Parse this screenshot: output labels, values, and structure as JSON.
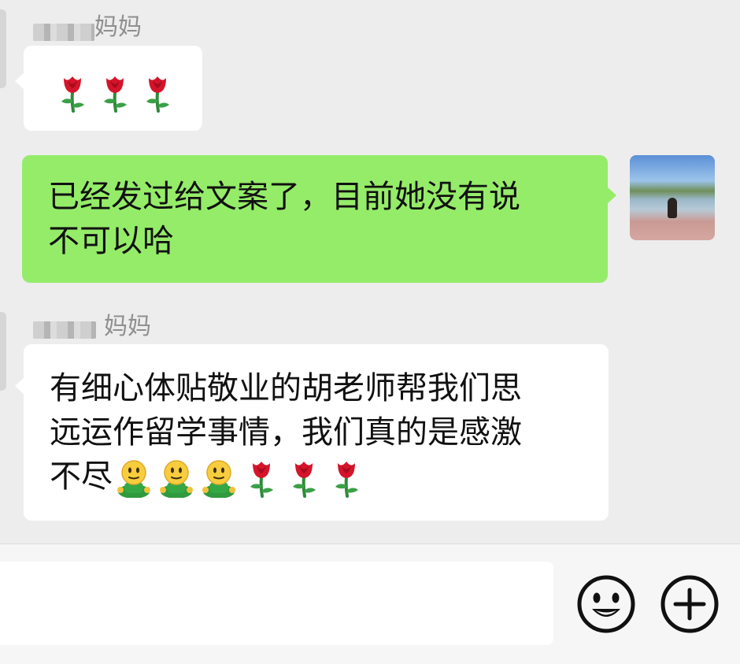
{
  "messages": [
    {
      "sender": "妈妈",
      "emojis": [
        "rose-emoji",
        "rose-emoji",
        "rose-emoji"
      ]
    },
    {
      "lines": [
        "已经发过给文案了，目前她没有说",
        "不可以哈"
      ]
    },
    {
      "sender": "妈妈",
      "lines": [
        "有细心体贴敬业的胡老师帮我们思",
        "远运作留学事情，我们真的是感激",
        "不尽"
      ],
      "trailing_emojis": [
        "smiley-person-emoji",
        "smiley-person-emoji",
        "smiley-person-emoji",
        "rose-emoji",
        "rose-emoji",
        "rose-emoji"
      ]
    }
  ],
  "input": {
    "value": "",
    "placeholder": ""
  },
  "icons": {
    "emoji_button": "smiley-face-icon",
    "more_button": "plus-circle-icon"
  },
  "colors": {
    "background": "#ededed",
    "incoming_bubble": "#ffffff",
    "outgoing_bubble": "#95ec69",
    "name_text": "#8f8f8f"
  }
}
